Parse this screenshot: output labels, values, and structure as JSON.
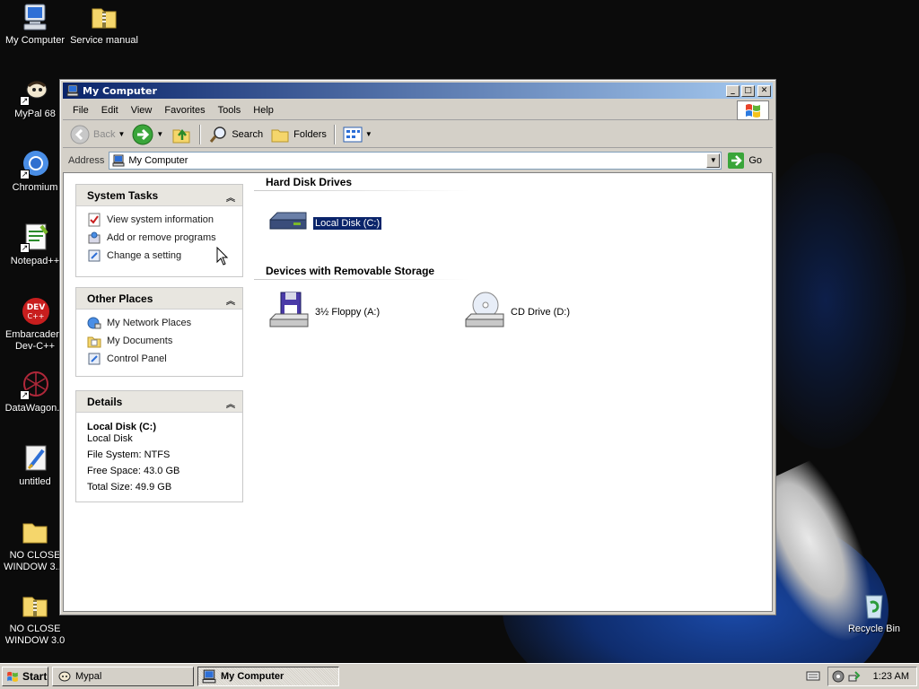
{
  "desktop": {
    "icons": [
      {
        "label": "My Computer",
        "icon": "my-computer-icon"
      },
      {
        "label": "Service manual",
        "icon": "zip-folder-icon"
      },
      {
        "label": "MyPal 68",
        "icon": "mypal-icon"
      },
      {
        "label": "Chromium",
        "icon": "chromium-icon"
      },
      {
        "label": "Notepad++",
        "icon": "notepad-plus-plus-icon"
      },
      {
        "label": "Embarcadero Dev-C++",
        "icon": "devcpp-icon"
      },
      {
        "label": "DataWagon...",
        "icon": "datawagon-icon"
      },
      {
        "label": "untitled",
        "icon": "paint-file-icon"
      },
      {
        "label": "NO CLOSE WINDOW 3....",
        "icon": "folder-icon"
      },
      {
        "label": "NO CLOSE WINDOW 3.0",
        "icon": "zip-folder-icon"
      },
      {
        "label": "Recycle Bin",
        "icon": "recycle-bin-icon"
      }
    ]
  },
  "window": {
    "title": "My Computer",
    "menu": [
      "File",
      "Edit",
      "View",
      "Favorites",
      "Tools",
      "Help"
    ],
    "toolbar": {
      "back": "Back",
      "search": "Search",
      "folders": "Folders"
    },
    "address": {
      "label": "Address",
      "value": "My Computer",
      "go": "Go"
    },
    "system_tasks": {
      "title": "System Tasks",
      "items": [
        "View system information",
        "Add or remove programs",
        "Change a setting"
      ]
    },
    "other_places": {
      "title": "Other Places",
      "items": [
        "My Network Places",
        "My Documents",
        "Control Panel"
      ]
    },
    "details": {
      "title": "Details",
      "name": "Local Disk (C:)",
      "type": "Local Disk",
      "file_system": "File System: NTFS",
      "free_space": "Free Space: 43.0 GB",
      "total_size": "Total Size: 49.9 GB"
    },
    "groups": {
      "hard_disks": "Hard Disk Drives",
      "removable": "Devices with Removable Storage"
    },
    "drives": {
      "c": "Local Disk (C:)",
      "a": "3½ Floppy (A:)",
      "d": "CD Drive (D:)"
    }
  },
  "taskbar": {
    "start": "Start",
    "tasks": [
      "Mypal",
      "My Computer"
    ],
    "clock": "1:23 AM"
  }
}
